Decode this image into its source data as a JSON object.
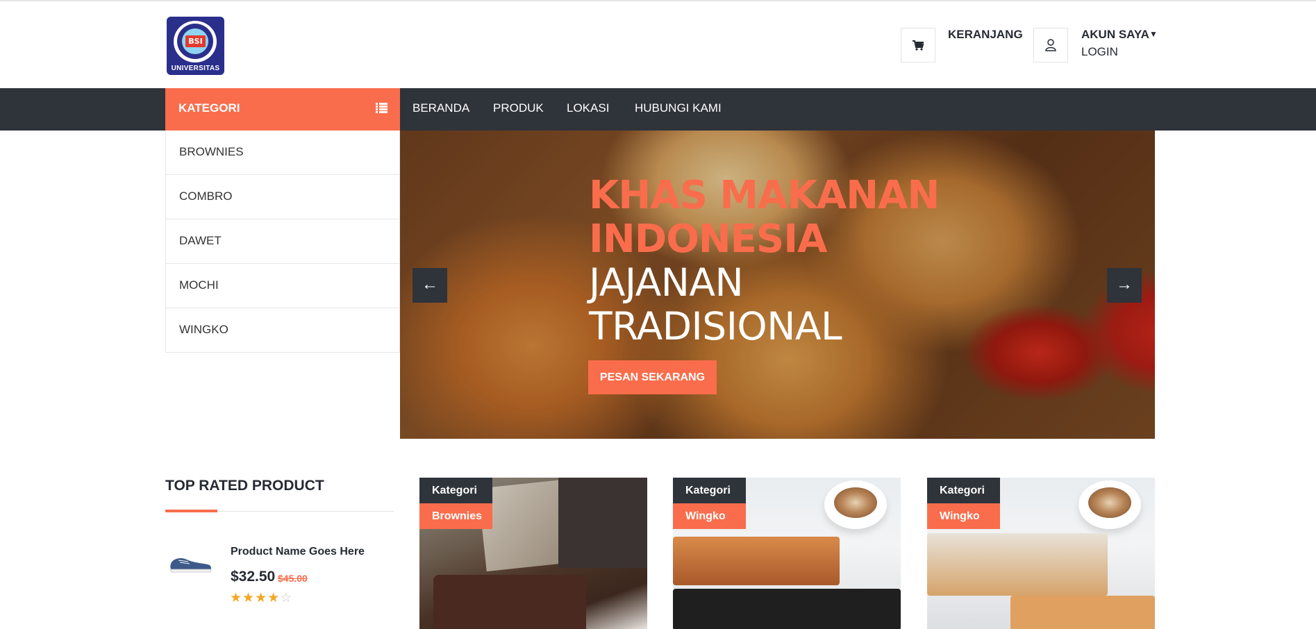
{
  "header": {
    "logo_text": "UNIVERSITAS",
    "cart_label": "KERANJANG",
    "account_label": "AKUN SAYA",
    "login_label": "LOGIN"
  },
  "nav": {
    "kategori_label": "KATEGORI",
    "items": [
      "BERANDA",
      "PRODUK",
      "LOKASI",
      "HUBUNGI KAMI"
    ]
  },
  "categories": [
    "BROWNIES",
    "COMBRO",
    "DAWET",
    "MOCHI",
    "WINGKO"
  ],
  "hero": {
    "title_line1": "KHAS MAKANAN",
    "title_line2": "INDONESIA",
    "subtitle_line1": "JAJANAN",
    "subtitle_line2": "TRADISIONAL",
    "button_label": "PESAN SEKARANG",
    "prev_arrow": "←",
    "next_arrow": "→"
  },
  "top_rated": {
    "title": "TOP RATED PRODUCT",
    "product_name": "Product Name Goes Here",
    "price": "$32.50",
    "old_price": "$45.00",
    "rating": 4,
    "rating_max": 5
  },
  "product_cards": [
    {
      "tag_label": "Kategori",
      "category": "Brownies"
    },
    {
      "tag_label": "Kategori",
      "category": "Wingko"
    },
    {
      "tag_label": "Kategori",
      "category": "Wingko"
    }
  ],
  "colors": {
    "accent": "#f96d4c",
    "dark": "#2f333a",
    "star": "#f5a623"
  },
  "icons": {
    "cart": "shopping-cart-icon",
    "user": "user-icon",
    "list": "list-icon",
    "caret": "caret-down-icon"
  }
}
